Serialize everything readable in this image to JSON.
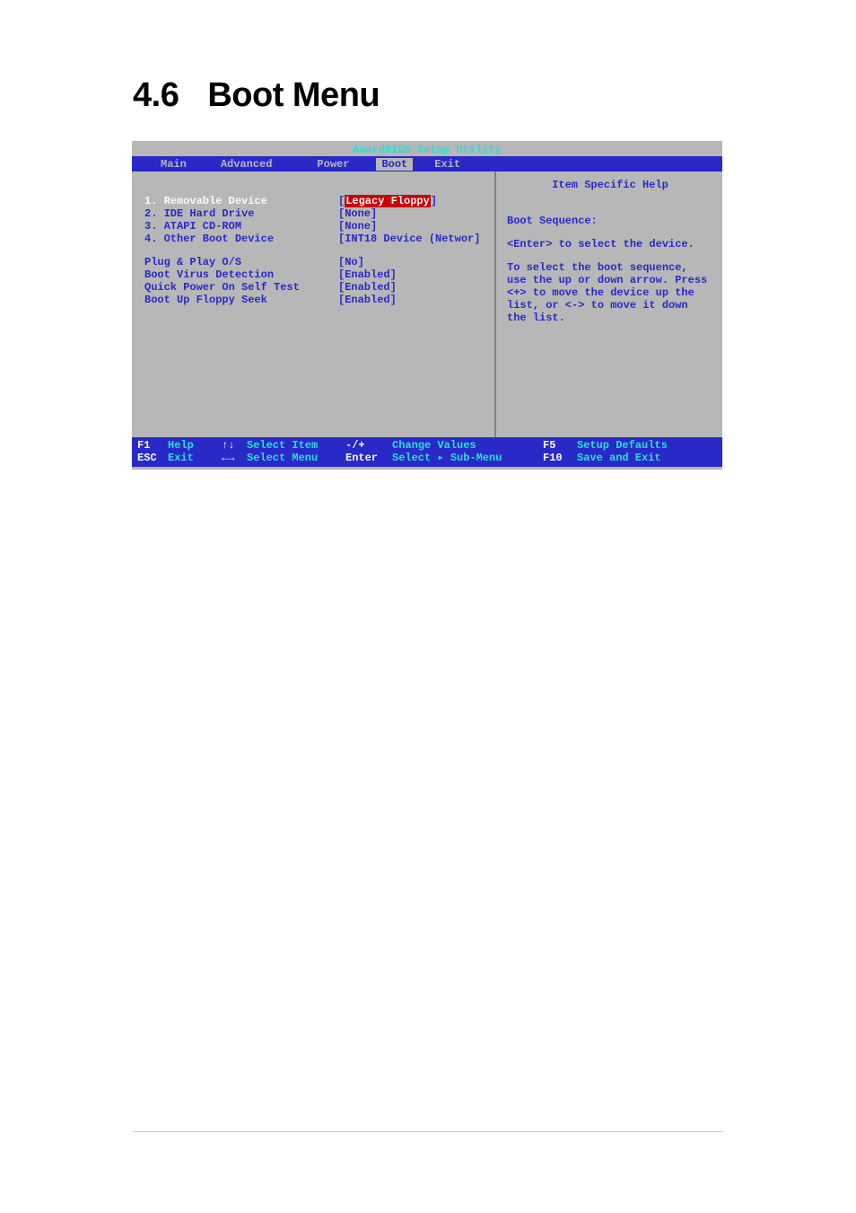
{
  "heading": {
    "number": "4.6",
    "title": "Boot Menu"
  },
  "bios": {
    "title": "AwardBIOS Setup Utility",
    "tabs": [
      "Main",
      "Advanced",
      "Power",
      "Boot",
      "Exit"
    ],
    "active_tab": "Boot",
    "rows": [
      {
        "label": "1. Removable Device",
        "value": "Legacy Floppy",
        "selected": true
      },
      {
        "label": "2. IDE Hard Drive",
        "value": "[None]"
      },
      {
        "label": "3. ATAPI CD-ROM",
        "value": "[None]"
      },
      {
        "label": "4. Other Boot Device",
        "value": "[INT18 Device (Networ]"
      }
    ],
    "rows2": [
      {
        "label": "Plug & Play O/S",
        "value": "[No]"
      },
      {
        "label": "Boot Virus Detection",
        "value": "[Enabled]"
      },
      {
        "label": "Quick Power On Self Test",
        "value": "[Enabled]"
      },
      {
        "label": "Boot Up Floppy Seek",
        "value": "[Enabled]"
      }
    ],
    "help": {
      "title": "Item Specific Help",
      "subtitle": "Boot Sequence:",
      "body1": "<Enter> to select the device.",
      "body2": "To select the boot sequence, use the up or down arrow. Press <+> to move the device up the list, or <-> to move it down the list."
    },
    "footer": {
      "f1": "F1",
      "help": "Help",
      "esc": "ESC",
      "exit": "Exit",
      "updown": "↑↓",
      "select_item": "Select Item",
      "leftright": "←→",
      "select_menu": "Select Menu",
      "plusminus": "-/+",
      "change_values": "Change Values",
      "enter": "Enter",
      "select_submenu": "Select ▸ Sub-Menu",
      "f5": "F5",
      "setup_defaults": "Setup Defaults",
      "f10": "F10",
      "save_exit": "Save and Exit"
    }
  }
}
